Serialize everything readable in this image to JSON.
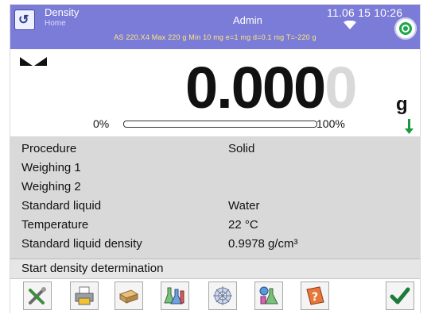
{
  "header": {
    "title": "Density",
    "subtitle": "Home",
    "user": "Admin",
    "datetime": "11.06 15 10:26",
    "specs": "AS 220.X4  Max 220 g  Min 10 mg  e=1 mg  d=0.1 mg  T=-220 g"
  },
  "display": {
    "reading_main": "0.000",
    "reading_ghost": "0",
    "unit": "g",
    "progress_start_label": "0%",
    "progress_end_label": "100%",
    "progress_fraction": 0.0
  },
  "parameters": [
    {
      "label": "Procedure",
      "value": "Solid"
    },
    {
      "label": "Weighing 1",
      "value": ""
    },
    {
      "label": "Weighing 2",
      "value": ""
    },
    {
      "label": "Standard liquid",
      "value": "Water"
    },
    {
      "label": "Temperature",
      "value": "22 °C"
    },
    {
      "label": "Standard liquid density",
      "value": "0.9978 g/cm³"
    }
  ],
  "action": {
    "label": "Start density determination"
  },
  "toolbar": {
    "icons": [
      "tools-icon",
      "printer-icon",
      "sponge-icon",
      "flasks-icon",
      "sun-icon",
      "chemistry-icon",
      "help-book-icon",
      "confirm-check-icon"
    ]
  },
  "colors": {
    "header_bg": "#7b7bd8",
    "params_bg": "#d9d9d9",
    "status_green": "#1aa64a",
    "check_green": "#1e7a3a"
  }
}
